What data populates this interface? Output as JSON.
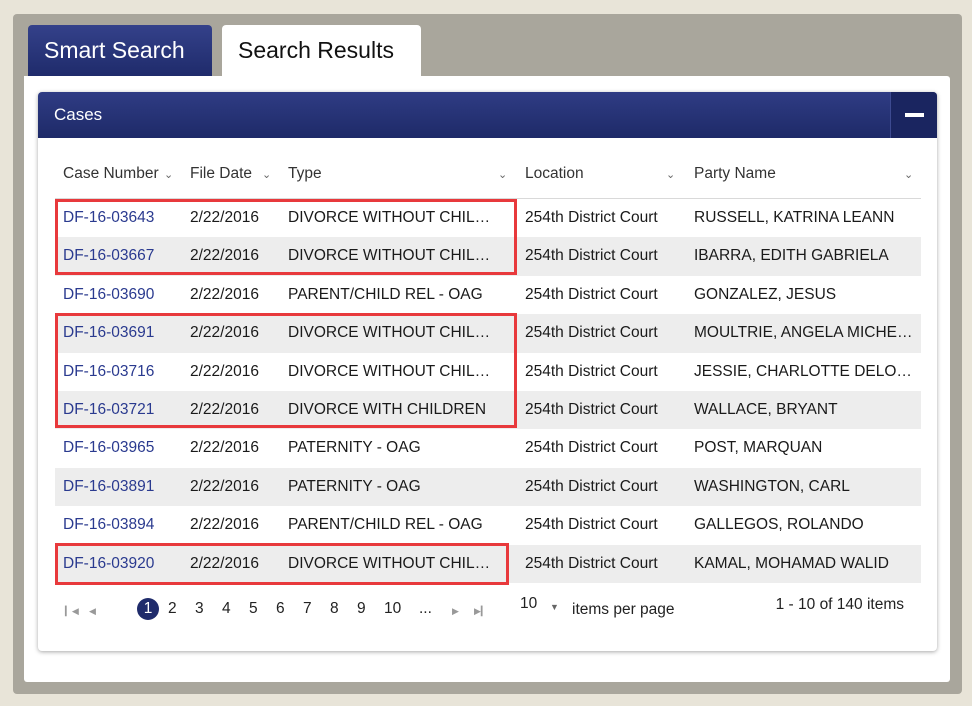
{
  "tabs": {
    "smart_search": "Smart Search",
    "search_results": "Search Results"
  },
  "panel": {
    "title": "Cases"
  },
  "columns": [
    "Case Number",
    "File Date",
    "Type",
    "Location",
    "Party Name"
  ],
  "rows": [
    {
      "case": "DF-16-03643",
      "date": "2/22/2016",
      "type": "DIVORCE WITHOUT CHILDREN",
      "location": "254th District Court",
      "party": "RUSSELL, KATRINA LEANN"
    },
    {
      "case": "DF-16-03667",
      "date": "2/22/2016",
      "type": "DIVORCE WITHOUT CHILDREN",
      "location": "254th District Court",
      "party": "IBARRA, EDITH GABRIELA"
    },
    {
      "case": "DF-16-03690",
      "date": "2/22/2016",
      "type": "PARENT/CHILD REL - OAG",
      "location": "254th District Court",
      "party": "GONZALEZ, JESUS"
    },
    {
      "case": "DF-16-03691",
      "date": "2/22/2016",
      "type": "DIVORCE WITHOUT CHILDREN",
      "location": "254th District Court",
      "party": "MOULTRIE, ANGELA MICHELLE"
    },
    {
      "case": "DF-16-03716",
      "date": "2/22/2016",
      "type": "DIVORCE WITHOUT CHILDREN",
      "location": "254th District Court",
      "party": "JESSIE, CHARLOTTE DELORES"
    },
    {
      "case": "DF-16-03721",
      "date": "2/22/2016",
      "type": "DIVORCE WITH CHILDREN",
      "location": "254th District Court",
      "party": "WALLACE, BRYANT"
    },
    {
      "case": "DF-16-03965",
      "date": "2/22/2016",
      "type": "PATERNITY - OAG",
      "location": "254th District Court",
      "party": "POST, MARQUAN"
    },
    {
      "case": "DF-16-03891",
      "date": "2/22/2016",
      "type": "PATERNITY - OAG",
      "location": "254th District Court",
      "party": "WASHINGTON, CARL"
    },
    {
      "case": "DF-16-03894",
      "date": "2/22/2016",
      "type": "PARENT/CHILD REL - OAG",
      "location": "254th District Court",
      "party": "GALLEGOS, ROLANDO"
    },
    {
      "case": "DF-16-03920",
      "date": "2/22/2016",
      "type": "DIVORCE WITHOUT CHILDREN",
      "location": "254th District Court",
      "party": "KAMAL, MOHAMAD WALID"
    }
  ],
  "pager": {
    "pages": [
      "1",
      "2",
      "3",
      "4",
      "5",
      "6",
      "7",
      "8",
      "9",
      "10",
      "..."
    ],
    "current_page": "1",
    "items_per_page_value": "10",
    "items_per_page_label": "items per page",
    "info": "1 - 10 of 140 items"
  },
  "colors": {
    "brand_navy": "#1f2b6b",
    "link": "#2a3a8f",
    "highlight": "#e8393c",
    "row_alt": "#ededed"
  },
  "icons": {
    "collapse": "minus-icon",
    "sort": "chevron-down-icon",
    "first": "first-page-icon",
    "prev": "prev-page-icon",
    "next": "next-page-icon",
    "last": "last-page-icon"
  }
}
